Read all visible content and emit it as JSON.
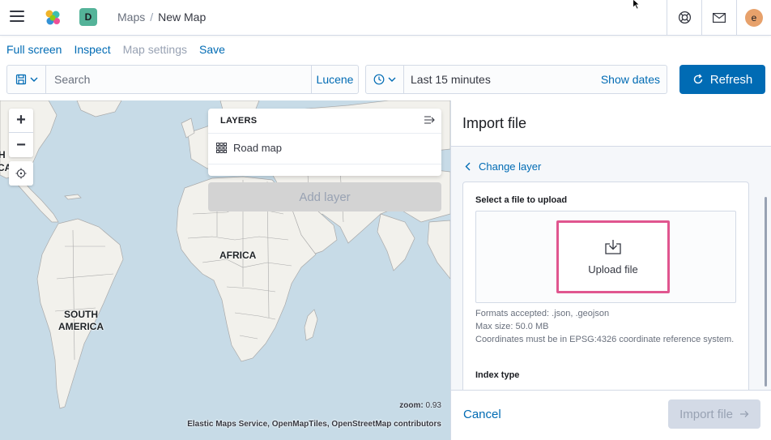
{
  "header": {
    "space_initial": "D",
    "breadcrumbs": {
      "parent": "Maps",
      "separator": "/",
      "current": "New Map"
    },
    "user_initial": "e"
  },
  "topnav": {
    "full_screen": "Full screen",
    "inspect": "Inspect",
    "map_settings": "Map settings",
    "save": "Save"
  },
  "query": {
    "search_placeholder": "Search",
    "language": "Lucene"
  },
  "datepicker": {
    "range": "Last 15 minutes",
    "show_dates": "Show dates"
  },
  "refresh_label": "Refresh",
  "map": {
    "labels": {
      "africa": "AFRICA",
      "south_america_1": "SOUTH",
      "south_america_2": "AMERICA",
      "partial_1": "H",
      "partial_2": "CA"
    },
    "zoom_label": "zoom:",
    "zoom_value": "0.93",
    "attribution": "Elastic Maps Service, OpenMapTiles, OpenStreetMap contributors",
    "layers": {
      "title": "LAYERS",
      "items": [
        {
          "label": "Road map",
          "icon": "grid-icon"
        }
      ],
      "add_layer": "Add layer"
    }
  },
  "flyout": {
    "title": "Import file",
    "change_layer": "Change layer",
    "select_label": "Select a file to upload",
    "upload_label": "Upload file",
    "formats": "Formats accepted: .json, .geojson",
    "max_size": "Max size: 50.0 MB",
    "coords": "Coordinates must be in EPSG:4326 coordinate reference system.",
    "index_type": "Index type",
    "cancel": "Cancel",
    "import": "Import file"
  },
  "colors": {
    "primary": "#006bb4",
    "water": "#c7dbe7",
    "land": "#f2f1ec",
    "highlight": "#e0568f",
    "space_badge": "#54b399",
    "avatar": "#e7a16b"
  }
}
